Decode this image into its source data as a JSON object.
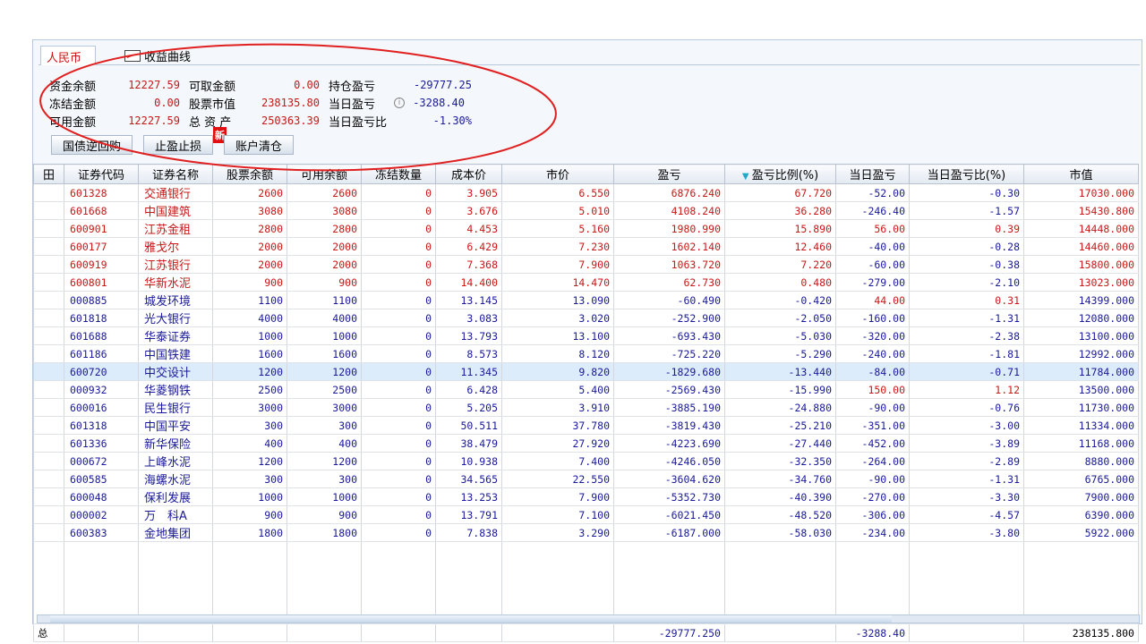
{
  "tabs": {
    "rmb": "人民币",
    "curve": "收益曲线"
  },
  "summary": {
    "rows": [
      [
        {
          "label": "资金余额",
          "value": "12227.59",
          "color": "red"
        },
        {
          "label": "可取金额",
          "value": "0.00",
          "color": "red"
        },
        {
          "label": "持仓盈亏",
          "value": "-29777.25",
          "color": "blue"
        }
      ],
      [
        {
          "label": "冻结金额",
          "value": "0.00",
          "color": "red"
        },
        {
          "label": "股票市值",
          "value": "238135.80",
          "color": "red"
        },
        {
          "label": "当日盈亏",
          "value": "-3288.40",
          "color": "blue"
        }
      ],
      [
        {
          "label": "可用金额",
          "value": "12227.59",
          "color": "red"
        },
        {
          "label": "总 资 产",
          "value": "250363.39",
          "color": "red"
        },
        {
          "label": "当日盈亏比",
          "value": "-1.30%",
          "color": "blue"
        }
      ]
    ]
  },
  "buttons": {
    "repo": "国债逆回购",
    "stop": "止盈止损",
    "new_badge": "新",
    "clear": "账户清仓"
  },
  "columns": [
    "田",
    "证券代码",
    "证券名称",
    "股票余额",
    "可用余额",
    "冻结数量",
    "成本价",
    "市价",
    "盈亏",
    "盈亏比例(%)",
    "当日盈亏",
    "当日盈亏比(%)",
    "市值"
  ],
  "sort_icon": "triangle-down",
  "rows": [
    [
      "601328",
      "交通银行",
      "2600",
      "2600",
      "0",
      "3.905",
      "6.550",
      "6876.240",
      "67.720",
      "-52.00",
      "-0.30",
      "17030.000"
    ],
    [
      "601668",
      "中国建筑",
      "3080",
      "3080",
      "0",
      "3.676",
      "5.010",
      "4108.240",
      "36.280",
      "-246.40",
      "-1.57",
      "15430.800"
    ],
    [
      "600901",
      "江苏金租",
      "2800",
      "2800",
      "0",
      "4.453",
      "5.160",
      "1980.990",
      "15.890",
      "56.00",
      "0.39",
      "14448.000"
    ],
    [
      "600177",
      "雅戈尔",
      "2000",
      "2000",
      "0",
      "6.429",
      "7.230",
      "1602.140",
      "12.460",
      "-40.00",
      "-0.28",
      "14460.000"
    ],
    [
      "600919",
      "江苏银行",
      "2000",
      "2000",
      "0",
      "7.368",
      "7.900",
      "1063.720",
      "7.220",
      "-60.00",
      "-0.38",
      "15800.000"
    ],
    [
      "600801",
      "华新水泥",
      "900",
      "900",
      "0",
      "14.400",
      "14.470",
      "62.730",
      "0.480",
      "-279.00",
      "-2.10",
      "13023.000"
    ],
    [
      "000885",
      "城发环境",
      "1100",
      "1100",
      "0",
      "13.145",
      "13.090",
      "-60.490",
      "-0.420",
      "44.00",
      "0.31",
      "14399.000"
    ],
    [
      "601818",
      "光大银行",
      "4000",
      "4000",
      "0",
      "3.083",
      "3.020",
      "-252.900",
      "-2.050",
      "-160.00",
      "-1.31",
      "12080.000"
    ],
    [
      "601688",
      "华泰证券",
      "1000",
      "1000",
      "0",
      "13.793",
      "13.100",
      "-693.430",
      "-5.030",
      "-320.00",
      "-2.38",
      "13100.000"
    ],
    [
      "601186",
      "中国铁建",
      "1600",
      "1600",
      "0",
      "8.573",
      "8.120",
      "-725.220",
      "-5.290",
      "-240.00",
      "-1.81",
      "12992.000"
    ],
    [
      "600720",
      "中交设计",
      "1200",
      "1200",
      "0",
      "11.345",
      "9.820",
      "-1829.680",
      "-13.440",
      "-84.00",
      "-0.71",
      "11784.000"
    ],
    [
      "000932",
      "华菱钢铁",
      "2500",
      "2500",
      "0",
      "6.428",
      "5.400",
      "-2569.430",
      "-15.990",
      "150.00",
      "1.12",
      "13500.000"
    ],
    [
      "600016",
      "民生银行",
      "3000",
      "3000",
      "0",
      "5.205",
      "3.910",
      "-3885.190",
      "-24.880",
      "-90.00",
      "-0.76",
      "11730.000"
    ],
    [
      "601318",
      "中国平安",
      "300",
      "300",
      "0",
      "50.511",
      "37.780",
      "-3819.430",
      "-25.210",
      "-351.00",
      "-3.00",
      "11334.000"
    ],
    [
      "601336",
      "新华保险",
      "400",
      "400",
      "0",
      "38.479",
      "27.920",
      "-4223.690",
      "-27.440",
      "-452.00",
      "-3.89",
      "11168.000"
    ],
    [
      "000672",
      "上峰水泥",
      "1200",
      "1200",
      "0",
      "10.938",
      "7.400",
      "-4246.050",
      "-32.350",
      "-264.00",
      "-2.89",
      "8880.000"
    ],
    [
      "600585",
      "海螺水泥",
      "300",
      "300",
      "0",
      "34.565",
      "22.550",
      "-3604.620",
      "-34.760",
      "-90.00",
      "-1.31",
      "6765.000"
    ],
    [
      "600048",
      "保利发展",
      "1000",
      "1000",
      "0",
      "13.253",
      "7.900",
      "-5352.730",
      "-40.390",
      "-270.00",
      "-3.30",
      "7900.000"
    ],
    [
      "000002",
      "万　科A",
      "900",
      "900",
      "0",
      "13.791",
      "7.100",
      "-6021.450",
      "-48.520",
      "-306.00",
      "-4.57",
      "6390.000"
    ],
    [
      "600383",
      "金地集团",
      "1800",
      "1800",
      "0",
      "7.838",
      "3.290",
      "-6187.000",
      "-58.030",
      "-234.00",
      "-3.80",
      "5922.000"
    ]
  ],
  "selected_row": 10,
  "totals": {
    "label": "总",
    "pnl": "-29777.250",
    "day_pnl": "-3288.40",
    "market_value": "238135.800"
  },
  "colors": {
    "up": "#c81818",
    "down": "#1a1a9a",
    "annotation": "#e02020"
  }
}
